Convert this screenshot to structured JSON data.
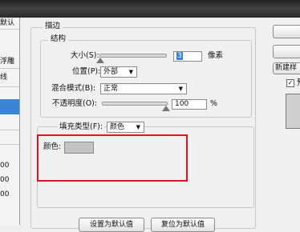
{
  "left_panel": {
    "items": [
      "默认",
      "浮雕",
      "线",
      "00",
      "00",
      "00"
    ]
  },
  "dialog": {
    "section_title": "描边",
    "structure": {
      "title": "结构",
      "size_label": "大小(S):",
      "size_value": "3",
      "size_unit": "像素",
      "position_label": "位置(P):",
      "position_value": "外部",
      "blend_mode_label": "混合模式(B):",
      "blend_mode_value": "正常",
      "opacity_label": "不透明度(O):",
      "opacity_value": "100",
      "opacity_unit": "%"
    },
    "fill": {
      "type_label": "填充类型(F):",
      "type_value": "颜色",
      "color_label": "颜色:",
      "color_hex": "#c3c3c3"
    },
    "bottom_buttons": [
      "设置为默认值",
      "复位为默认值"
    ]
  },
  "right_side": {
    "new_style_button": "新建样",
    "preview_checked": true,
    "preview_label": "预"
  },
  "colors": {
    "highlight": "#e0121d",
    "selection": "#3a84d6"
  }
}
